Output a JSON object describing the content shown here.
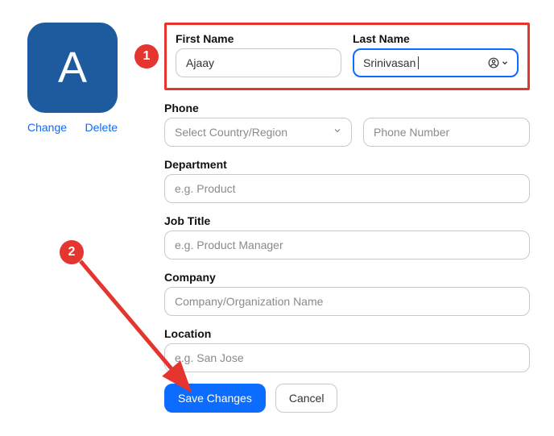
{
  "avatar": {
    "initial": "A",
    "change": "Change",
    "delete": "Delete"
  },
  "annotations": {
    "badge1": "1",
    "badge2": "2"
  },
  "fields": {
    "first_name": {
      "label": "First Name",
      "value": "Ajaay"
    },
    "last_name": {
      "label": "Last Name",
      "value": "Srinivasan"
    },
    "phone": {
      "label": "Phone",
      "country_placeholder": "Select Country/Region",
      "number_placeholder": "Phone Number"
    },
    "department": {
      "label": "Department",
      "placeholder": "e.g. Product"
    },
    "job_title": {
      "label": "Job Title",
      "placeholder": "e.g. Product Manager"
    },
    "company": {
      "label": "Company",
      "placeholder": "Company/Organization Name"
    },
    "location": {
      "label": "Location",
      "placeholder": "e.g. San Jose"
    }
  },
  "buttons": {
    "save": "Save Changes",
    "cancel": "Cancel"
  }
}
